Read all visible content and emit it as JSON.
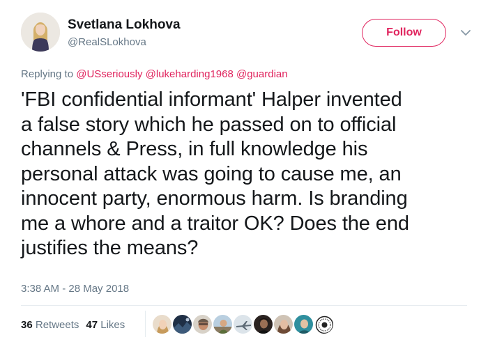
{
  "author": {
    "display_name": "Svetlana Lokhova",
    "handle": "@RealSLokhova",
    "avatar_icon": "woman-portrait-avatar"
  },
  "follow_button": {
    "label": "Follow",
    "color": "#e0245e"
  },
  "menu_icon": "chevron-down-icon",
  "reply": {
    "prefix": "Replying to",
    "mentions": [
      "@USseriously",
      "@lukeharding1968",
      "@guardian"
    ]
  },
  "tweet": {
    "text": "'FBI confidential informant' Halper invented\na false story which he passed on to official\nchannels & Press, in full knowledge his\npersonal attack was going to cause me, an\ninnocent party, enormous harm. Is branding\nme a whore and a traitor OK? Does the end\njustifies the means?",
    "timestamp": "3:38 AM - 28 May 2018"
  },
  "stats": {
    "retweets_count": "36",
    "retweets_label": "Retweets",
    "likes_count": "47",
    "likes_label": "Likes"
  },
  "likers": [
    {
      "icon": "woman-face-avatar",
      "color": "#d9b99b"
    },
    {
      "icon": "dark-landscape-avatar",
      "color": "#2c3e50"
    },
    {
      "icon": "man-face-avatar",
      "color": "#a8876b"
    },
    {
      "icon": "person-outdoor-avatar",
      "color": "#c9a583"
    },
    {
      "icon": "airplane-avatar",
      "color": "#b8c4cc"
    },
    {
      "icon": "dark-portrait-avatar",
      "color": "#3a2e2a"
    },
    {
      "icon": "woman-smiling-avatar",
      "color": "#b48f76"
    },
    {
      "icon": "teal-portrait-avatar",
      "color": "#3b9aa6"
    },
    {
      "icon": "badge-logo-avatar",
      "color": "#f2f2f2"
    }
  ],
  "colors": {
    "accent": "#e0245e",
    "text": "#14171a",
    "muted": "#657786",
    "divider": "#e6ecf0"
  }
}
